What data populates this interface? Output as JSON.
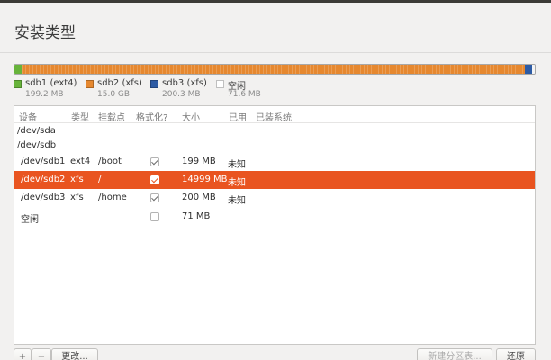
{
  "window": {
    "title": "安装类型"
  },
  "partition_bar": {
    "segments": [
      {
        "name": "sdb1",
        "color": "#67b33a"
      },
      {
        "name": "sdb2",
        "color": "#e6882f"
      },
      {
        "name": "sdb3",
        "color": "#2d5ba4"
      },
      {
        "name": "free",
        "color": "#f4f4f4"
      }
    ]
  },
  "legend": [
    {
      "label": "sdb1 (ext4)",
      "size": "199.2 MB",
      "color": "#67b33a"
    },
    {
      "label": "sdb2 (xfs)",
      "size": "15.0 GB",
      "color": "#e6882f"
    },
    {
      "label": "sdb3 (xfs)",
      "size": "200.3 MB",
      "color": "#2d5ba4"
    },
    {
      "label": "空闲",
      "size": "71.6 MB",
      "color": "#ffffff"
    }
  ],
  "table": {
    "columns": [
      "设备",
      "类型",
      "挂载点",
      "格式化?",
      "大小",
      "已用",
      "已装系统"
    ],
    "rows": [
      {
        "device": "/dev/sda",
        "type": "",
        "mount": "",
        "format": null,
        "size": "",
        "used": "",
        "system": ""
      },
      {
        "device": "/dev/sdb",
        "type": "",
        "mount": "",
        "format": null,
        "size": "",
        "used": "",
        "system": ""
      },
      {
        "device": "/dev/sdb1",
        "type": "ext4",
        "mount": "/boot",
        "format": true,
        "size": "199 MB",
        "used": "未知",
        "system": ""
      },
      {
        "device": "/dev/sdb2",
        "type": "xfs",
        "mount": "/",
        "format": true,
        "size": "14999 MB",
        "used": "未知",
        "system": "",
        "selected": true
      },
      {
        "device": "/dev/sdb3",
        "type": "xfs",
        "mount": "/home",
        "format": true,
        "size": "200 MB",
        "used": "未知",
        "system": ""
      },
      {
        "device": "空闲",
        "type": "",
        "mount": "",
        "format": false,
        "size": "71 MB",
        "used": "",
        "system": ""
      }
    ]
  },
  "buttons": {
    "add": "+",
    "remove": "−",
    "change": "更改...",
    "new_partition_table": "新建分区表...",
    "revert": "还原"
  },
  "colors": {
    "accent": "#e95420",
    "background": "#f2f1f0"
  }
}
